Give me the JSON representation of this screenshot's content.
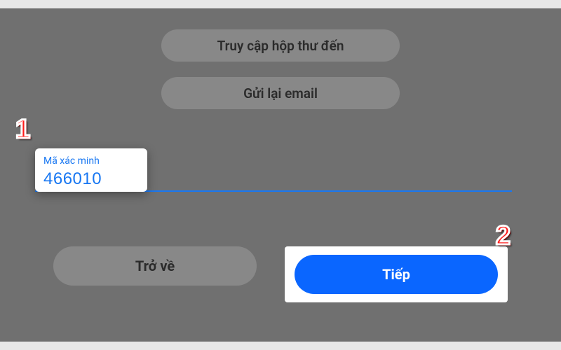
{
  "buttons": {
    "inbox": "Truy cập hộp thư đến",
    "resend": "Gửi lại email",
    "back": "Trở về",
    "next": "Tiếp"
  },
  "verification": {
    "label": "Mã xác minh",
    "value": "466010"
  },
  "annotations": {
    "step1": "1",
    "step2": "2"
  }
}
